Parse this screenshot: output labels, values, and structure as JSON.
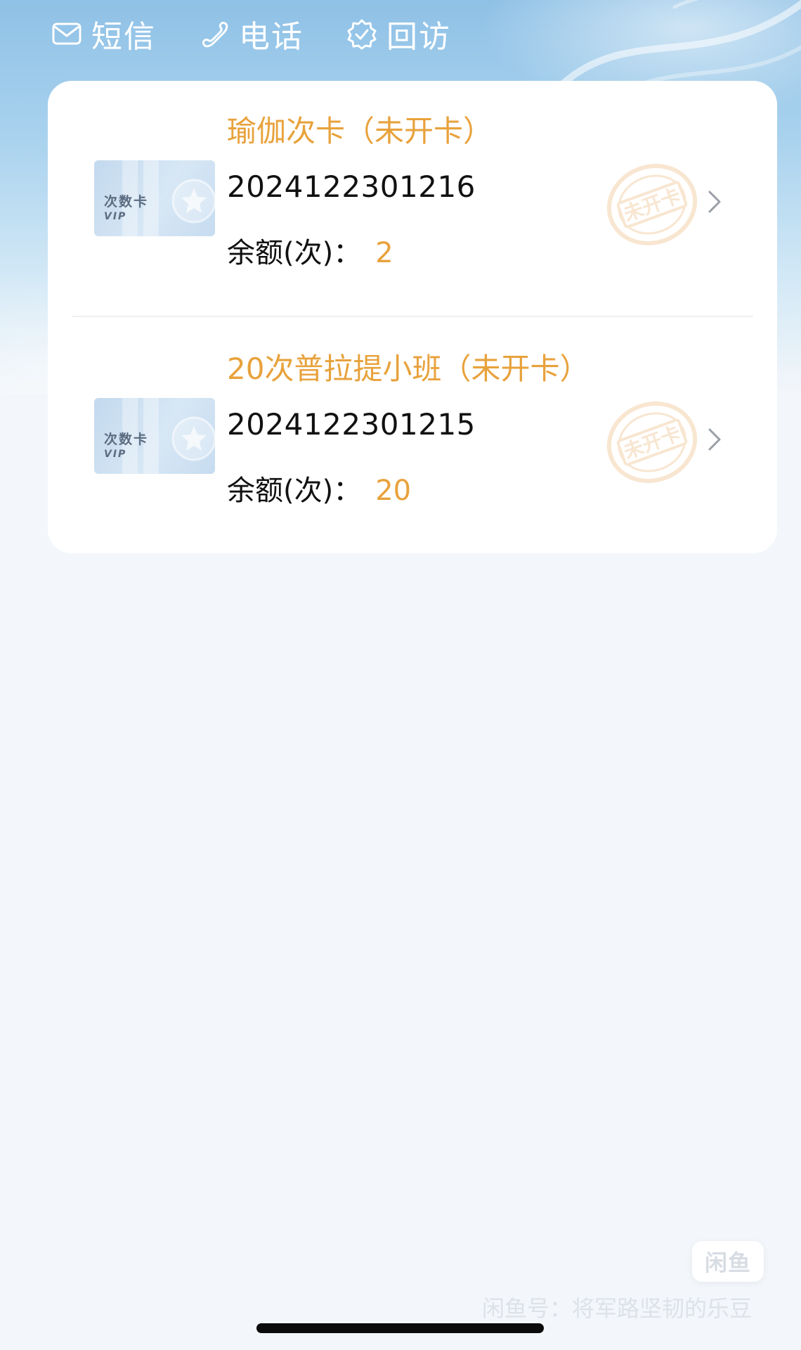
{
  "actions": [
    {
      "label": "短信",
      "icon": "message-icon"
    },
    {
      "label": "电话",
      "icon": "phone-icon"
    },
    {
      "label": "回访",
      "icon": "follow-up-icon"
    }
  ],
  "cards": [
    {
      "title": "瑜伽次卡（未开卡）",
      "card_no": "2024122301216",
      "balance_label": "余额(次)：",
      "balance_value": "2",
      "thumb_text": "次数卡",
      "thumb_sub": "VIP",
      "stamp_text": "未开卡"
    },
    {
      "title": "20次普拉提小班（未开卡）",
      "card_no": "2024122301215",
      "balance_label": "余额(次)：",
      "balance_value": "20",
      "thumb_text": "次数卡",
      "thumb_sub": "VIP",
      "stamp_text": "未开卡"
    }
  ],
  "fab_label": "闲鱼",
  "watermark": "闲鱼号：将军路坚韧的乐豆",
  "colors": {
    "accent": "#e8a23c",
    "header_bg": "#8fc1e6",
    "page_bg": "#f3f6fa"
  }
}
